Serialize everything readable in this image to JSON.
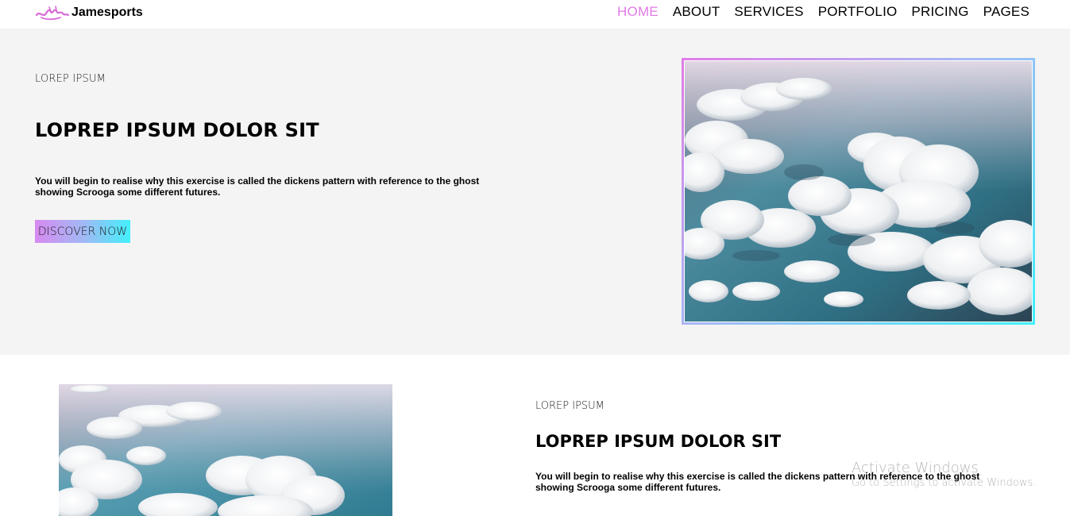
{
  "header": {
    "brand_name": "Jamesports",
    "nav": [
      {
        "label": "HOME",
        "active": true
      },
      {
        "label": "ABOUT",
        "active": false
      },
      {
        "label": "SERVICES",
        "active": false
      },
      {
        "label": "PORTFOLIO",
        "active": false
      },
      {
        "label": "PRICING",
        "active": false
      },
      {
        "label": "PAGES",
        "active": false
      }
    ]
  },
  "hero": {
    "eyebrow": "LOREP IPSUM",
    "title": "LOPREP IPSUM DOLOR SIT",
    "text": "You will begin to realise why this exercise is called the dickens pattern with reference to the ghost showing Scrooga some different futures.",
    "button_label": "DISCOVER NOW"
  },
  "section2": {
    "eyebrow": "LOREP IPSUM",
    "title": "LOPREP IPSUM DOLOR SIT",
    "text": "You will begin to realise why this exercise is called the dickens pattern with reference to the ghost showing Scrooga some different futures."
  },
  "watermark": {
    "title": "Activate Windows",
    "subtitle": "Go to Settings to activate Windows."
  },
  "colors": {
    "accent_pink": "#e27be6",
    "accent_cyan": "#3ef1fb",
    "hero_bg": "#f4f4f4"
  }
}
